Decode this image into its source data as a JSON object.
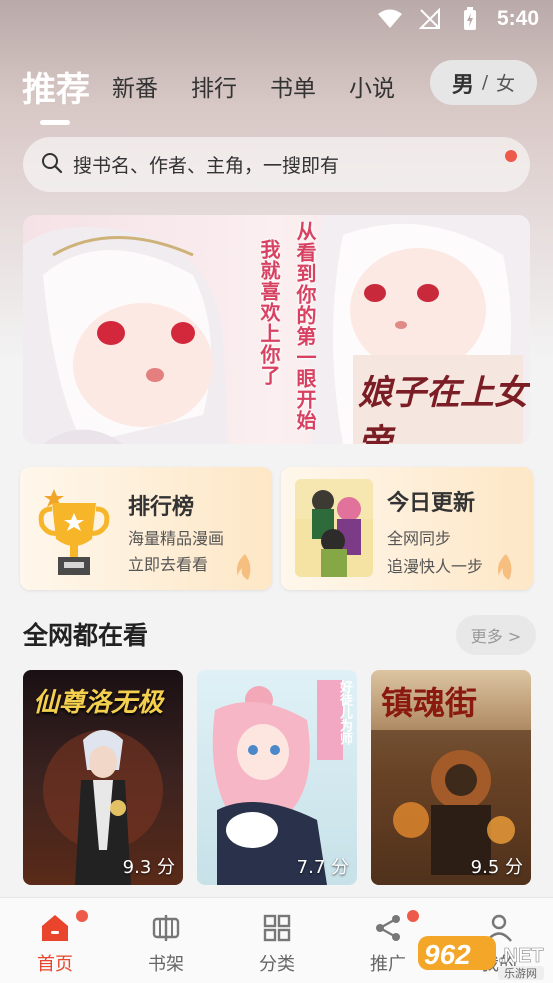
{
  "status_bar": {
    "time": "5:40"
  },
  "tabs": [
    "推荐",
    "新番",
    "排行",
    "书单",
    "小说"
  ],
  "gender": {
    "male": "男",
    "separator": "/",
    "female": "女"
  },
  "search": {
    "placeholder": "搜书名、作者、主角，一搜即有"
  },
  "banner": {
    "text_col1": "从看到你的第一眼开始",
    "text_col2": "我就喜欢上你了",
    "logo": "娘子在上女帝"
  },
  "cards": {
    "ranking": {
      "title": "排行榜",
      "line1": "海量精品漫画",
      "line2": "立即去看看"
    },
    "today": {
      "title": "今日更新",
      "line1": "全网同步",
      "line2": "追漫快人一步"
    }
  },
  "section": {
    "title": "全网都在看",
    "more": "更多 >"
  },
  "books": [
    {
      "title": "仙尊洛无极",
      "score": "9.3 分"
    },
    {
      "title": "好徒儿为师",
      "score": "7.7 分"
    },
    {
      "title": "镇魂街",
      "score": "9.5 分"
    }
  ],
  "bottom_nav": [
    "首页",
    "书架",
    "分类",
    "推广",
    "我的"
  ],
  "watermark": {
    "text": "962",
    "suffix": ".NET",
    "sub": "乐游网"
  },
  "colors": {
    "accent": "#e8452c",
    "dot": "#ee5a4a"
  }
}
